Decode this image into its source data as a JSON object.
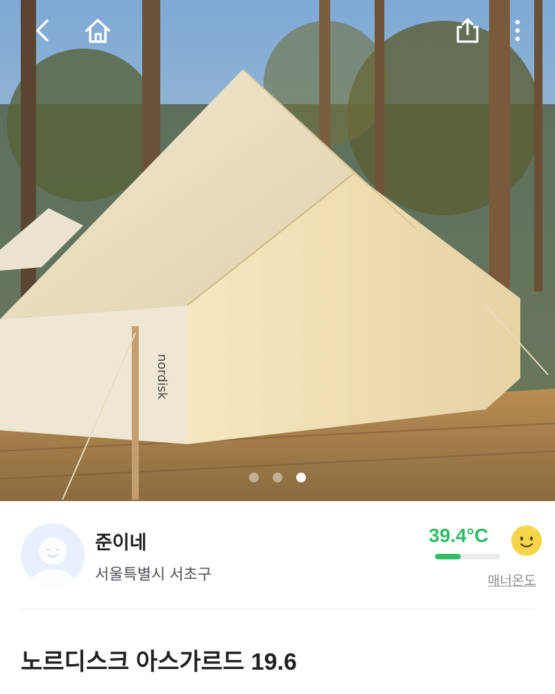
{
  "photo": {
    "description_icon": "tent-photo",
    "slide_count": 3,
    "active_slide": 3
  },
  "topbar": {
    "back_icon": "chevron-left-icon",
    "home_icon": "home-icon",
    "share_icon": "share-icon",
    "more_icon": "more-vertical-icon"
  },
  "seller": {
    "nickname": "준이네",
    "region": "서울특별시 서초구",
    "manner_temp": "39.4°C",
    "manner_temp_value": 39.4,
    "manner_label": "매너온도"
  },
  "product": {
    "title": "노르디스크 아스가르드 19.6"
  },
  "colors": {
    "accent_green": "#2fbd68",
    "text_primary": "#212124",
    "text_secondary": "#868b94"
  }
}
